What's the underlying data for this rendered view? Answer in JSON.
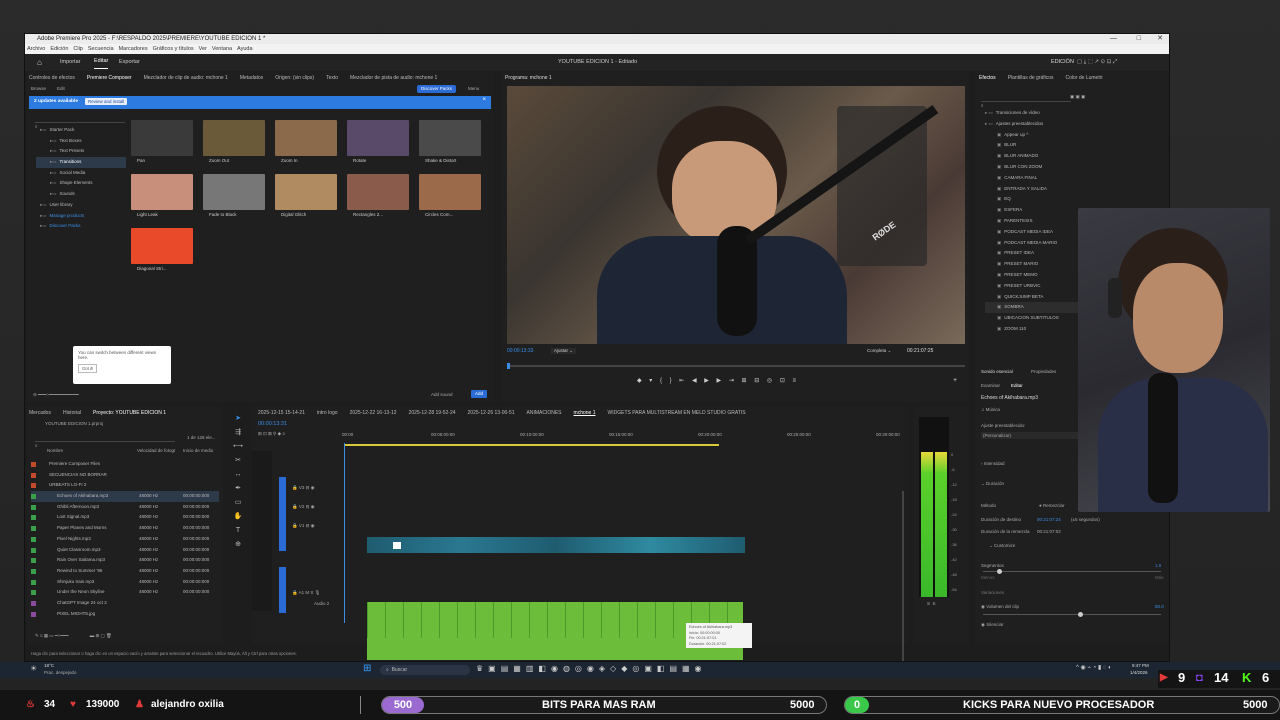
{
  "app": {
    "title": "Adobe Premiere Pro 2025 - F:\\RESPALDO 2025\\PREMIERE\\YOUTUBE EDICION 1 *",
    "menus": [
      "Archivo",
      "Edición",
      "Clip",
      "Secuencia",
      "Marcadores",
      "Gráficos y títulos",
      "Ver",
      "Ventana",
      "Ayuda"
    ],
    "workspace_tabs": [
      "Importar",
      "Editar",
      "Exportar"
    ],
    "project_title": "YOUTUBE EDICION 1 - Editado",
    "workspace_label": "EDICIÓN"
  },
  "source_panel": {
    "tabs": [
      "Controles de efectos",
      "Premiere Composer",
      "Mezclador de clip de audio: mchone 1",
      "Metadatos",
      "Origen: (sin clips)",
      "Texto",
      "Mezclador de pista de audio: mchone 1"
    ],
    "subtabs": [
      "Browse",
      "Edit"
    ],
    "discover_button": "Discover Packs",
    "menu_label": "Menu",
    "update_text": "2 updates available",
    "update_button": "Review and install",
    "tree": [
      "Starter Pack",
      "Text Boxes",
      "Text Presets",
      "Transitions",
      "Social Media",
      "Shape Elements",
      "Sounds",
      "User library",
      "Manage products",
      "Discover Packs"
    ],
    "thumbs": [
      {
        "label": "Pan",
        "color": "#3a3a3a"
      },
      {
        "label": "Zoom Out",
        "color": "#6b5a3a"
      },
      {
        "label": "Zoom In",
        "color": "#8a6a4a"
      },
      {
        "label": "Rotate",
        "color": "#5a4a6a"
      },
      {
        "label": "Shake & Distort",
        "color": "#4a4a4a"
      },
      {
        "label": "Light Leak",
        "color": "#c8907a"
      },
      {
        "label": "Fade to Black",
        "color": "#777777"
      },
      {
        "label": "Digital Glitch",
        "color": "#b08a60"
      },
      {
        "label": "Rectangles 2...",
        "color": "#8a5a4a"
      },
      {
        "label": "Circles Com...",
        "color": "#9a6a4a"
      },
      {
        "label": "Diagonal Stri...",
        "color": "#e84a2a"
      }
    ],
    "tooltip_text": "You can switch between different views here.",
    "tooltip_button": "Got it!",
    "add_sound": "Add sound",
    "add_button": "Add"
  },
  "program": {
    "title": "Programa: mchone 1",
    "timecode": "00:00:13:33",
    "fit": "Ajustar",
    "quality": "Completa",
    "duration": "00:21:07:25",
    "video_label": "RØDE"
  },
  "effects": {
    "tabs": [
      "Efectos",
      "Plantillas de gráficos",
      "Color de Lumetri"
    ],
    "items": [
      "Transiciones de vídeo",
      "Ajustes preestablecidos",
      "Appear up ^",
      "BLUR",
      "BLUR ANIMADO",
      "BLUR CON ZOOM",
      "CAMARA FINAL",
      "ENTRADA Y SALIDA",
      "EQ",
      "ESFERA",
      "PARENTESIS",
      "PODCAST MEDIA IDEA",
      "PODCAST MEDIA MARIO",
      "PRESET IDEA",
      "PRESET MARIO",
      "PRESET MEMO",
      "PRESET URBVIC",
      "QUICKJUMP BETA",
      "SOMBRA",
      "UBICACION SUBTITULOS",
      "ZOOM 110"
    ]
  },
  "essential_sound": {
    "tabs": [
      "Sonido esencial",
      "Propiedades"
    ],
    "subtabs": [
      "Examinar",
      "Editar"
    ],
    "clip": "Echoes of Akihabara.mp3",
    "type": "Música",
    "preset_label": "Ajuste preestablecido:",
    "preset_value": "(Personalizar)",
    "intensity": "Intensidad",
    "duration_section": "Duración",
    "method_label": "Método",
    "method_value": "Remezclar",
    "target_label": "Duración de destino",
    "target_value": "00:21:07:24",
    "target_note": "(±5 segundos)",
    "remix_label": "Duración de la remezcla",
    "remix_value": "00:21:07:02",
    "customize": "Customize",
    "segments": "Segmentos",
    "segments_value": "1.0",
    "minus": "Menos",
    "more": "Más",
    "variations": "Variaciones",
    "clip_volume": "Volumen del clip",
    "clip_volume_value": "50.0",
    "silence": "Silenciar"
  },
  "project_panel": {
    "tabs": [
      "Mercados",
      "Historial",
      "Proyecto: YOUTUBE EDICION 1"
    ],
    "file": "YOUTUBE EDICION 1.prproj",
    "count": "1 de 128 ele...",
    "columns": [
      "Nombre",
      "Velocidad de fotogr",
      "Inicio de medio"
    ],
    "rows": [
      {
        "name": "Premiere Composer Files",
        "rate": "",
        "start": "",
        "color": "#c04a2a"
      },
      {
        "name": "SECUENCIAS NO BORRAR",
        "rate": "",
        "start": "",
        "color": "#c04a2a"
      },
      {
        "name": "URBEATS LO-FI 2",
        "rate": "",
        "start": "",
        "color": "#c04a2a"
      },
      {
        "name": "Echoes of Akihabara.mp3",
        "rate": "48000 Hz",
        "start": "00:00:00:000",
        "color": "#3aa04a"
      },
      {
        "name": "Ghibli Afternoon.mp3",
        "rate": "48000 Hz",
        "start": "00:00:00:000",
        "color": "#3aa04a"
      },
      {
        "name": "Lost Signal.mp3",
        "rate": "48000 Hz",
        "start": "00:00:00:000",
        "color": "#3aa04a"
      },
      {
        "name": "Paper Planes and Morns",
        "rate": "48000 Hz",
        "start": "00:00:00:000",
        "color": "#3aa04a"
      },
      {
        "name": "Pixel Nights.mp3",
        "rate": "48000 Hz",
        "start": "00:00:00:000",
        "color": "#3aa04a"
      },
      {
        "name": "Quiet Classroom.mp3",
        "rate": "48000 Hz",
        "start": "00:00:00:000",
        "color": "#3aa04a"
      },
      {
        "name": "Rain Over Saitama.mp3",
        "rate": "48000 Hz",
        "start": "00:00:00:000",
        "color": "#3aa04a"
      },
      {
        "name": "Rewind to Summer '95",
        "rate": "48000 Hz",
        "start": "00:00:00:000",
        "color": "#3aa04a"
      },
      {
        "name": "Shinjuku train.mp3",
        "rate": "48000 Hz",
        "start": "00:00:00:000",
        "color": "#3aa04a"
      },
      {
        "name": "Under the Neon Skyline",
        "rate": "48000 Hz",
        "start": "00:00:00:000",
        "color": "#3aa04a"
      },
      {
        "name": "ChatGPT Image 24 oct 2",
        "rate": "",
        "start": "",
        "color": "#8a4aa0"
      },
      {
        "name": "PIXEL MIGHT5.jpg",
        "rate": "",
        "start": "",
        "color": "#8a4aa0"
      }
    ]
  },
  "timeline": {
    "tabs": [
      "2025-12-15 15-14-21",
      "intro logo",
      "2025-12-22 16-13-12",
      "2025-12-28 19-52-24",
      "2025-12-26 13-00-51",
      "ANIMACIONES",
      "mchone 1",
      "WIDGETS PARA MULTISTREAM EN MELD STUDIO GRATIS"
    ],
    "timecode": "00:00:13:31",
    "ruler": [
      "00:00",
      "00:05:00:00",
      "00:10:00:00",
      "00:15:00:00",
      "00:20:00:00",
      "00:25:00:00",
      "00:30:00:00"
    ],
    "tracks": [
      "V3",
      "V2",
      "V1",
      "A1"
    ],
    "audio_label": "Audio 2",
    "tooltip": [
      "Echoes of Akihabara.mp3",
      "Inicio: 00:00:00:00",
      "Fin: 00:21:07:01",
      "Duración: 00:21:07:02"
    ]
  },
  "meter_scale": [
    "0",
    "-6",
    "-12",
    "-18",
    "-24",
    "-30",
    "-36",
    "-42",
    "-48",
    "-54"
  ],
  "status_text": "Haga clic para seleccionar o haga clic en un espacio vacío y arrastre para seleccionar el recuadro. Utilice Mayús, Alt y Ctrl para otras opciones.",
  "taskbar": {
    "weather_temp": "18°C",
    "weather_desc": "Prac. despejado",
    "search": "Buscar",
    "time": "9:47 PM",
    "date": "1/4/2026"
  },
  "overlay": {
    "stats": [
      {
        "value": "34",
        "color": "#e03a3a"
      },
      {
        "value": "139000",
        "color": "#e03a3a"
      }
    ],
    "user": "alejandro oxilia",
    "goal1": {
      "badge": "500",
      "label": "BITS PARA MAS RAM",
      "target": "5000",
      "color": "#9a6ad0"
    },
    "goal2": {
      "badge": "0",
      "label": "KICKS PARA NUEVO PROCESADOR",
      "target": "5000",
      "color": "#3ac84a"
    },
    "platforms": [
      {
        "icon": "youtube-icon",
        "value": "9",
        "color": "#e03a3a"
      },
      {
        "icon": "twitch-icon",
        "value": "14",
        "color": "#9146ff"
      },
      {
        "icon": "kick-icon",
        "value": "6",
        "color": "#53fc18"
      }
    ]
  }
}
